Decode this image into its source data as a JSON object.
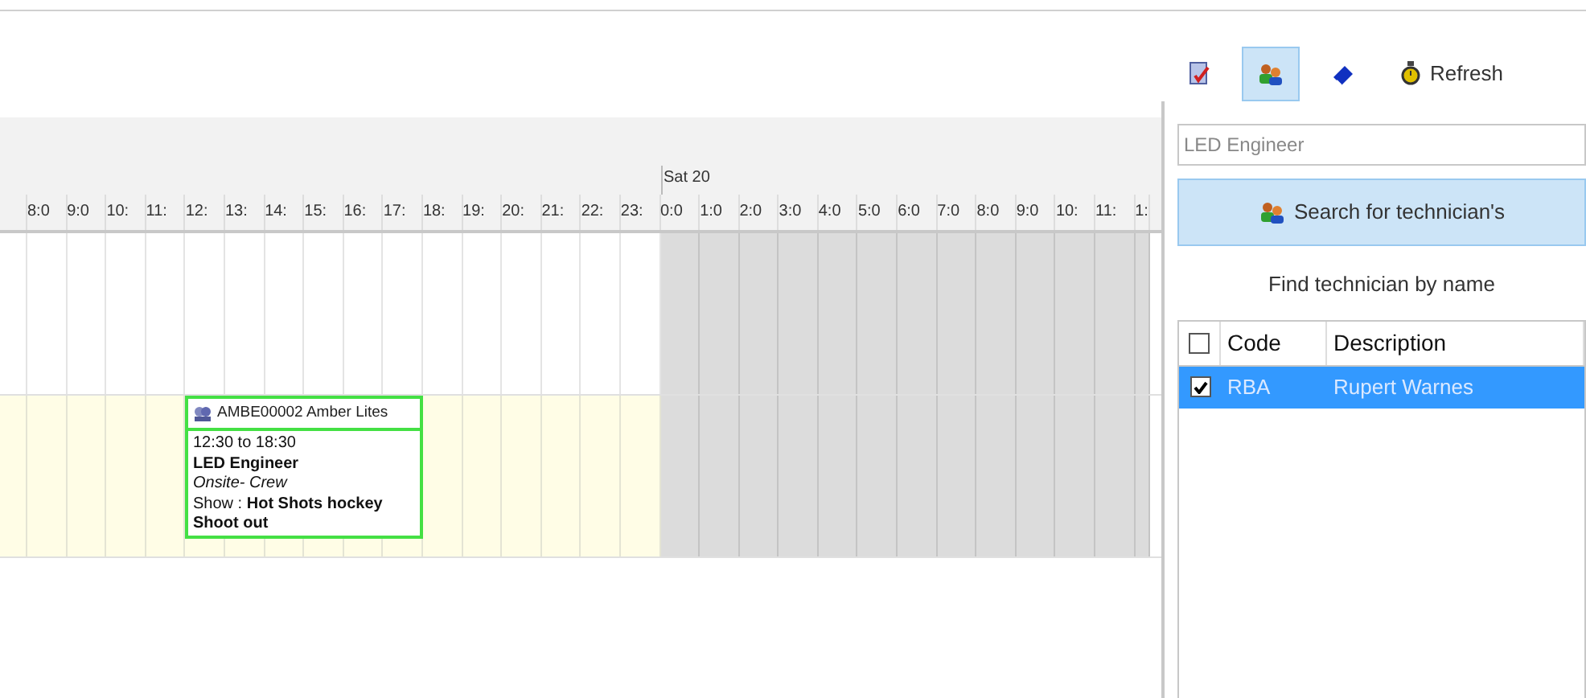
{
  "toolbar": {
    "buttons": [
      {
        "kind": "report",
        "selected": false
      },
      {
        "kind": "people",
        "selected": true
      },
      {
        "kind": "eraser",
        "selected": false
      },
      {
        "kind": "refresh",
        "label": "Refresh",
        "selected": false
      }
    ]
  },
  "scheduler": {
    "days": [
      {
        "weekend": false,
        "hours": [
          "8:0",
          "9:0",
          "10:",
          "11:",
          "12:",
          "13:",
          "14:",
          "15:",
          "16:",
          "17:",
          "18:",
          "19:",
          "20:",
          "21:",
          "22:",
          "23:"
        ]
      },
      {
        "label": "Sat 20",
        "weekend": true,
        "hours": [
          "0:0",
          "1:0",
          "2:0",
          "3:0",
          "4:0",
          "5:0",
          "6:0",
          "7:0",
          "8:0",
          "9:0",
          "10:",
          "11:",
          "1:"
        ]
      }
    ],
    "rows": [
      {
        "highlighted": false,
        "events": []
      },
      {
        "highlighted": true,
        "events": [
          {
            "title": "AMBE00002 Amber Lites",
            "time": "12:30 to 18:30",
            "role": "LED Engineer",
            "crew": "Onsite- Crew",
            "show": "Show : **Hot Shots hockey Shoot out**"
          }
        ]
      }
    ]
  },
  "panel": {
    "search": {
      "value": "LED Engineer"
    },
    "search_button": "Search for technician's",
    "hint": "Find technician by name",
    "table": {
      "header_checked": false,
      "columns": [
        "Code",
        "Description"
      ],
      "rows": [
        {
          "checked": true,
          "selected": true,
          "cells": [
            "RBA",
            "Rupert Warnes"
          ]
        }
      ]
    }
  }
}
